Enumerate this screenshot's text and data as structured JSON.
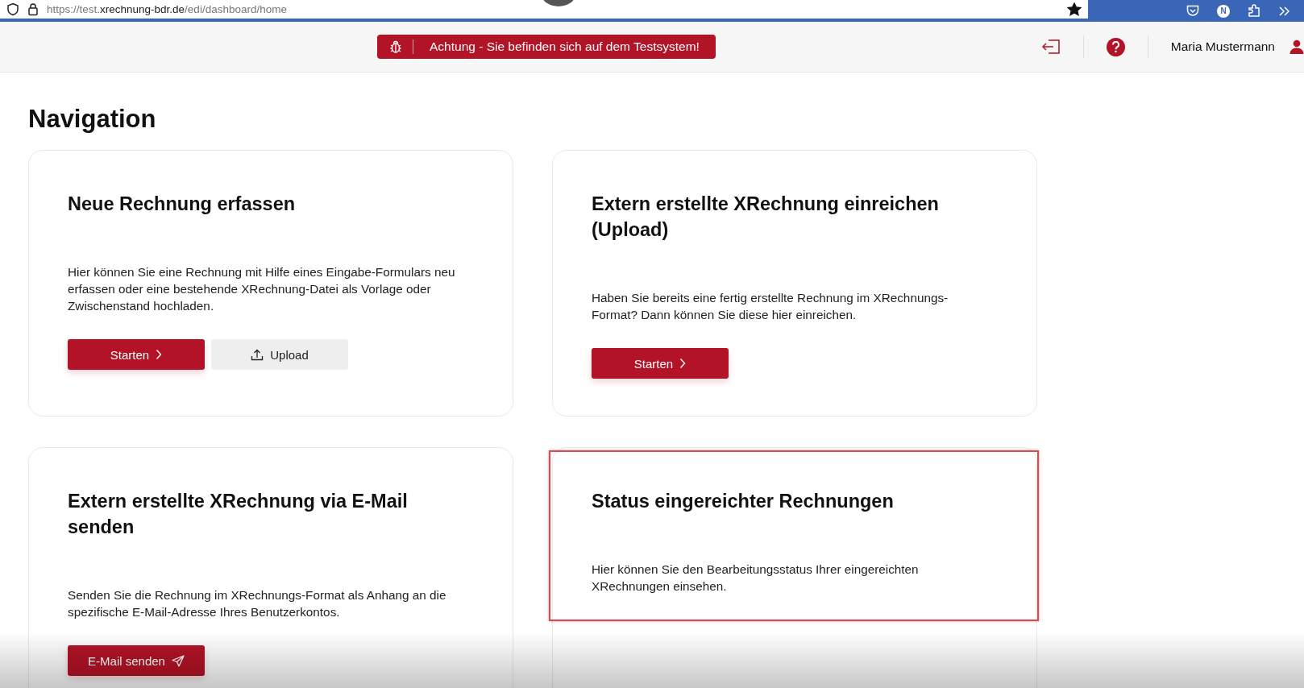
{
  "browser": {
    "url_parts": [
      {
        "text": "https://test.",
        "emphasis": false
      },
      {
        "text": "xrechnung-bdr.de",
        "emphasis": true
      },
      {
        "text": "/edi/dashboard/home",
        "emphasis": false
      }
    ],
    "bookmarked": true,
    "profile_initial": "N"
  },
  "header": {
    "banner": "Achtung - Sie befinden sich auf dem Testsystem!",
    "user_name": "Maria Mustermann"
  },
  "page_title": "Navigation",
  "cards": [
    {
      "title": "Neue Rechnung erfassen",
      "description": "Hier können Sie eine Rechnung mit Hilfe eines Eingabe-Formulars neu erfassen oder eine bestehende XRechnung-Datei als Vorlage oder Zwischenstand hochladen.",
      "highlighted": false,
      "buttons": [
        {
          "label": "Starten",
          "kind": "start"
        },
        {
          "label": "Upload",
          "kind": "upload"
        }
      ]
    },
    {
      "title": "Extern erstellte XRechnung einreichen (Upload)",
      "description": "Haben Sie bereits eine fertig erstellte Rechnung im XRechnungs-Format? Dann können Sie diese hier einreichen.",
      "highlighted": false,
      "buttons": [
        {
          "label": "Starten",
          "kind": "start"
        }
      ]
    },
    {
      "title": "Extern erstellte XRechnung via E-Mail senden",
      "description": "Senden Sie die Rechnung im XRechnungs-Format als Anhang an die spezifische E-Mail-Adresse Ihres Benutzerkontos.",
      "highlighted": false,
      "buttons": [
        {
          "label": "E-Mail senden",
          "kind": "email"
        }
      ]
    },
    {
      "title": "Status eingereichter Rechnungen",
      "description": "Hier können Sie den Bearbeitungsstatus Ihrer eingereichten XRechnungen einsehen.",
      "highlighted": true
    }
  ]
}
